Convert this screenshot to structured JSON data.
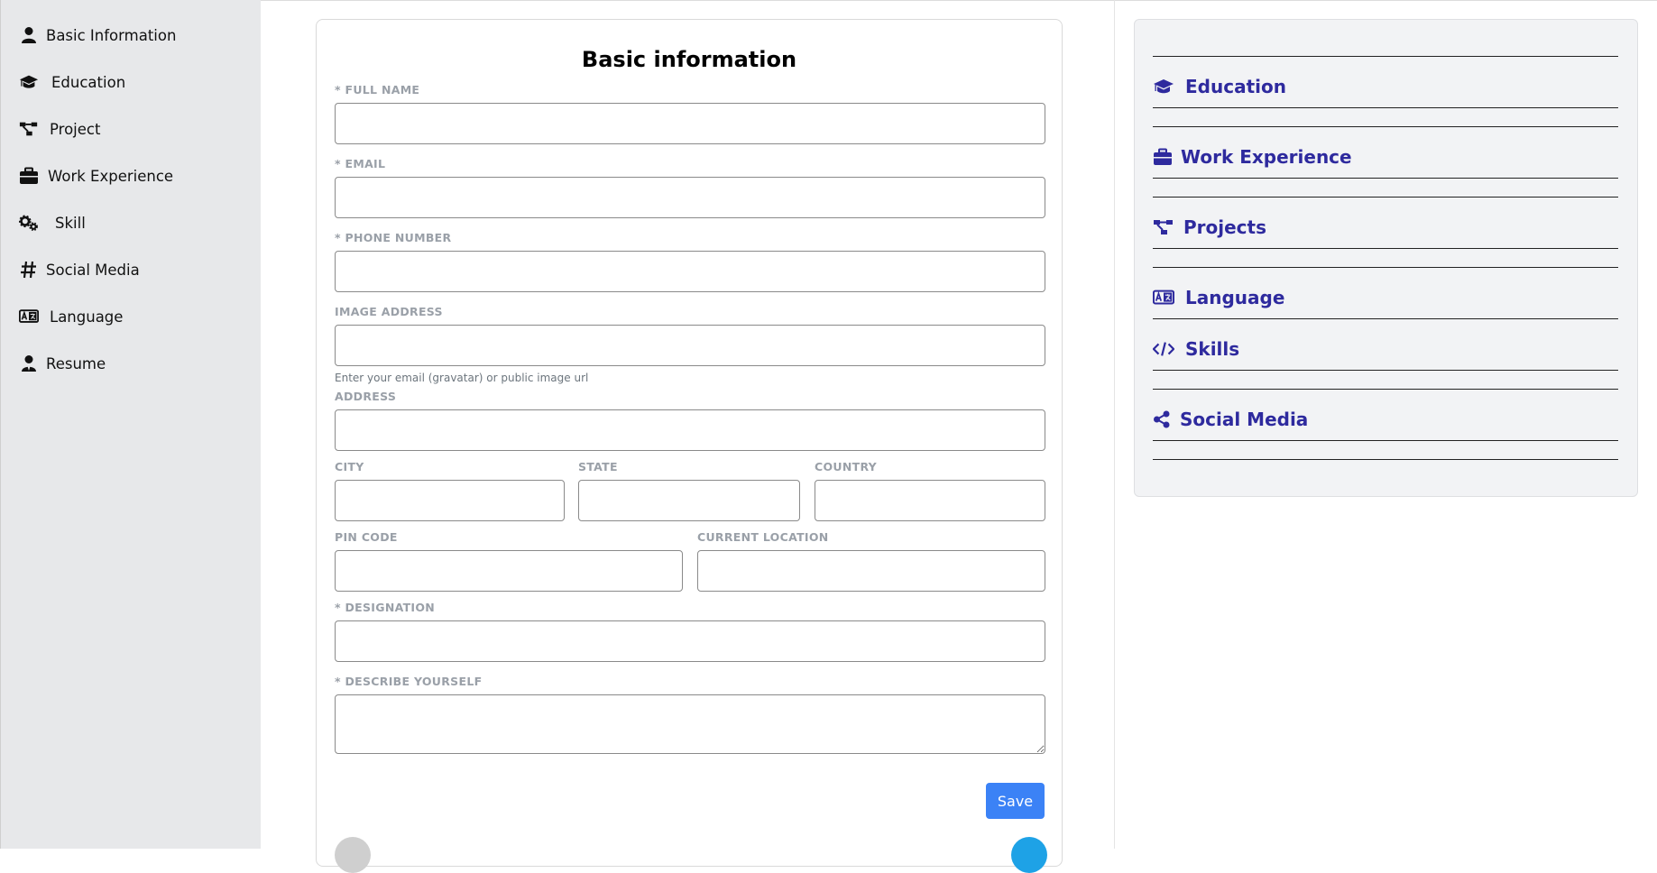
{
  "sidebar": {
    "items": [
      {
        "label": "Basic Information",
        "icon": "user-icon"
      },
      {
        "label": "Education",
        "icon": "graduation-cap-icon"
      },
      {
        "label": "Project",
        "icon": "project-diagram-icon"
      },
      {
        "label": "Work Experience",
        "icon": "briefcase-icon"
      },
      {
        "label": "Skill",
        "icon": "gears-icon"
      },
      {
        "label": "Social Media",
        "icon": "hashtag-icon"
      },
      {
        "label": "Language",
        "icon": "language-icon"
      },
      {
        "label": "Resume",
        "icon": "user-tie-icon"
      }
    ]
  },
  "form": {
    "title": "Basic information",
    "full_name_label": "* FULL NAME",
    "email_label": "* EMAIL",
    "phone_label": "* PHONE NUMBER",
    "image_label": "IMAGE ADDRESS",
    "image_hint": "Enter your email (gravatar) or public image url",
    "address_label": "ADDRESS",
    "city_label": "CITY",
    "state_label": "STATE",
    "country_label": "COUNTRY",
    "pin_label": "PIN CODE",
    "location_label": "CURRENT LOCATION",
    "designation_label": "* DESIGNATION",
    "describe_label": "* DESCRIBE YOURSELF",
    "save_label": "Save"
  },
  "preview": {
    "items": [
      {
        "label": "Education",
        "icon": "graduation-cap-icon"
      },
      {
        "label": "Work Experience",
        "icon": "briefcase-icon"
      },
      {
        "label": "Projects",
        "icon": "project-diagram-icon"
      },
      {
        "label": "Language",
        "icon": "language-icon"
      },
      {
        "label": "Skills",
        "icon": "code-icon"
      },
      {
        "label": "Social Media",
        "icon": "share-icon"
      }
    ]
  },
  "colors": {
    "accent": "#2e2a9e",
    "primary_button": "#3b82f6",
    "sidebar_bg": "#e7e8ea"
  }
}
